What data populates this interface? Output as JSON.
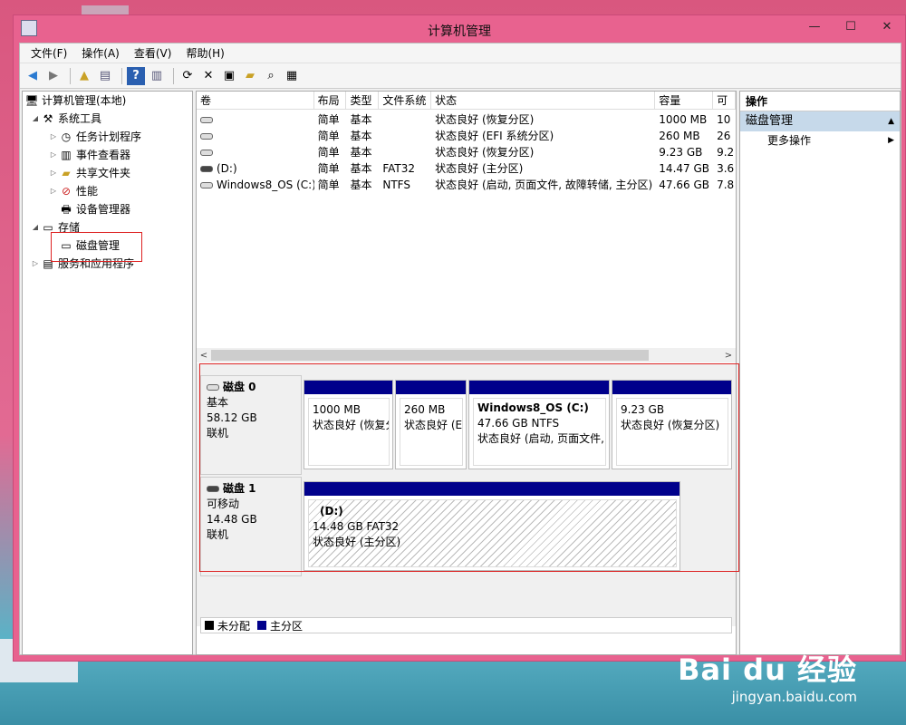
{
  "window": {
    "title": "计算机管理",
    "min": "—",
    "max": "☐",
    "close": "✕"
  },
  "menu": [
    "文件(F)",
    "操作(A)",
    "查看(V)",
    "帮助(H)"
  ],
  "tree": {
    "root": "计算机管理(本地)",
    "system_tools": "系统工具",
    "task_scheduler": "任务计划程序",
    "event_viewer": "事件查看器",
    "shared_folders": "共享文件夹",
    "performance": "性能",
    "device_manager": "设备管理器",
    "storage": "存储",
    "disk_management": "磁盘管理",
    "services": "服务和应用程序"
  },
  "volumes": {
    "headers": [
      "卷",
      "布局",
      "类型",
      "文件系统",
      "状态",
      "容量",
      "可"
    ],
    "rows": [
      [
        "",
        "简单",
        "基本",
        "",
        "状态良好 (恢复分区)",
        "1000 MB",
        "10"
      ],
      [
        "",
        "简单",
        "基本",
        "",
        "状态良好 (EFI 系统分区)",
        "260 MB",
        "26"
      ],
      [
        "",
        "简单",
        "基本",
        "",
        "状态良好 (恢复分区)",
        "9.23 GB",
        "9.2"
      ],
      [
        "(D:)",
        "简单",
        "基本",
        "FAT32",
        "状态良好 (主分区)",
        "14.47 GB",
        "3.6"
      ],
      [
        "Windows8_OS (C:)",
        "简单",
        "基本",
        "NTFS",
        "状态良好 (启动, 页面文件, 故障转储, 主分区)",
        "47.66 GB",
        "7.8"
      ]
    ]
  },
  "disk0": {
    "name": "磁盘 0",
    "type": "基本",
    "size": "58.12 GB",
    "status": "联机",
    "parts": [
      {
        "title": "",
        "line1": "1000 MB",
        "line2": "状态良好 (恢复分"
      },
      {
        "title": "",
        "line1": "260 MB",
        "line2": "状态良好 (EI"
      },
      {
        "title": "Windows8_OS  (C:)",
        "line1": "47.66 GB NTFS",
        "line2": "状态良好 (启动, 页面文件,"
      },
      {
        "title": "",
        "line1": "9.23 GB",
        "line2": "状态良好 (恢复分区)"
      }
    ]
  },
  "disk1": {
    "name": "磁盘 1",
    "type": "可移动",
    "size": "14.48 GB",
    "status": "联机",
    "part": {
      "title": "(D:)",
      "line1": "14.48 GB FAT32",
      "line2": "状态良好 (主分区)"
    }
  },
  "legend": [
    {
      "label": "未分配",
      "color": "#000000"
    },
    {
      "label": "主分区",
      "color": "#00008b"
    }
  ],
  "actions": {
    "header": "操作",
    "section": "磁盘管理",
    "more": "更多操作"
  },
  "watermark": {
    "brand": "Bai du 经验",
    "url": "jingyan.baidu.com"
  },
  "colors": {
    "titlebar": "#e8628f",
    "partition_bar": "#00008b",
    "highlight": "#d22222"
  }
}
